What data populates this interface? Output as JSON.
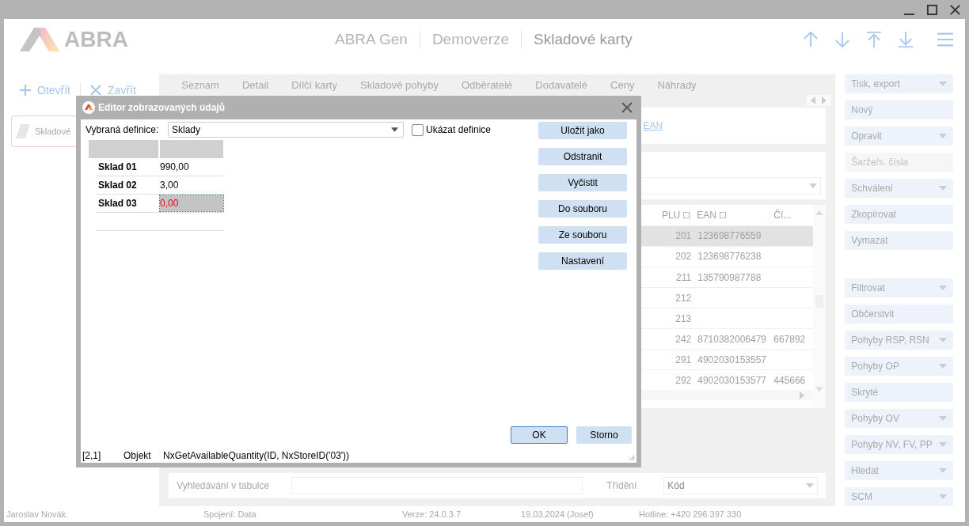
{
  "header": {
    "logo": "ABRA",
    "product": "ABRA Gen",
    "edition": "Demoverze",
    "title": "Skladové karty"
  },
  "left_toolbar": [
    {
      "label": "Otevřít",
      "kind": "open"
    },
    {
      "label": "Zavřít",
      "kind": "close"
    }
  ],
  "open_cards": [
    {
      "label": "Skladové",
      "selected": true
    }
  ],
  "tabs": [
    "Seznam",
    "Detail",
    "Dílčí karty",
    "Skladové pohyby",
    "Odběratelé",
    "Dodavatelé",
    "Ceny",
    "Náhrady"
  ],
  "links": [
    "EAN"
  ],
  "grid": {
    "columns": [
      "PLU",
      "EAN",
      "Čí..."
    ],
    "rows": [
      {
        "plu": "201",
        "ean": "123698776559",
        "column_3": "",
        "selected": true
      },
      {
        "plu": "202",
        "ean": "123698776238",
        "column_3": "",
        "selected": false
      },
      {
        "plu": "211",
        "ean": "135790987788",
        "column_3": "",
        "selected": false
      },
      {
        "plu": "212",
        "ean": "",
        "column_3": "",
        "selected": false
      },
      {
        "plu": "213",
        "ean": "",
        "column_3": "",
        "selected": false
      },
      {
        "plu": "242",
        "ean": "8710382006479",
        "column_3": "667892",
        "selected": false
      },
      {
        "plu": "291",
        "ean": "4902030153557",
        "column_3": "",
        "selected": false
      },
      {
        "plu": "292",
        "ean": "4902030153577",
        "column_3": "445666",
        "selected": false
      }
    ]
  },
  "search": {
    "label": "Vyhledávání v tabulce"
  },
  "sort": {
    "label": "Třídění",
    "value": "Kód"
  },
  "actions_top": [
    {
      "label": "Tisk, export",
      "kind": "dropdown",
      "disabled": false
    },
    {
      "label": "Nový",
      "kind": "plain",
      "disabled": false
    },
    {
      "label": "Opravit",
      "kind": "dropdown",
      "disabled": false
    },
    {
      "label": "Šarže/s. čísla",
      "kind": "plain",
      "disabled": true
    },
    {
      "label": "Schválení",
      "kind": "dropdown",
      "disabled": false
    },
    {
      "label": "Zkopírovat",
      "kind": "plain",
      "disabled": false
    },
    {
      "label": "Vymazat",
      "kind": "plain",
      "disabled": false
    }
  ],
  "actions_bottom": [
    {
      "label": "Filtrovat",
      "kind": "dropdown",
      "disabled": false
    },
    {
      "label": "Občerstvit",
      "kind": "plain",
      "disabled": false
    },
    {
      "label": "Pohyby RSP, RSN",
      "kind": "dropdown",
      "disabled": false
    },
    {
      "label": "Pohyby OP",
      "kind": "dropdown",
      "disabled": false
    },
    {
      "label": "Skryté",
      "kind": "plain",
      "disabled": false
    },
    {
      "label": "Pohyby OV",
      "kind": "dropdown",
      "disabled": false
    },
    {
      "label": "Pohyby NV, FV, PP",
      "kind": "dropdown",
      "disabled": false
    },
    {
      "label": "Hledat",
      "kind": "dropdown",
      "disabled": false
    },
    {
      "label": "SCM",
      "kind": "dropdown",
      "disabled": false
    }
  ],
  "status_bar": [
    "Jaroslav Novák",
    "Spojení: Data",
    "Verze: 24.0.3.7",
    "19.03.2024 (Josef)",
    "Hotline: +420 296 397 330"
  ],
  "dialog": {
    "title": "Editor zobrazovaných údajů",
    "definition_label": "Vybraná definice:",
    "definition_value": "Sklady",
    "show_definition": {
      "label": "Ukázat definice",
      "checked": false
    },
    "rows": [
      {
        "name": "Sklad 01",
        "value": "990,00",
        "selected": false,
        "negative": false
      },
      {
        "name": "Sklad 02",
        "value": "3,00",
        "selected": false,
        "negative": false
      },
      {
        "name": "Sklad 03",
        "value": "0,00",
        "selected": true,
        "negative": true
      }
    ],
    "buttons": [
      "Uložit jako",
      "Odstranit",
      "Vyčistit",
      "Do souboru",
      "Ze souboru",
      "Nastavení"
    ],
    "ok": "OK",
    "cancel": "Storno",
    "status": [
      "[2,1]",
      "Objekt",
      "NxGetAvailableQuantity(ID, NxStoreID('03'))"
    ]
  }
}
